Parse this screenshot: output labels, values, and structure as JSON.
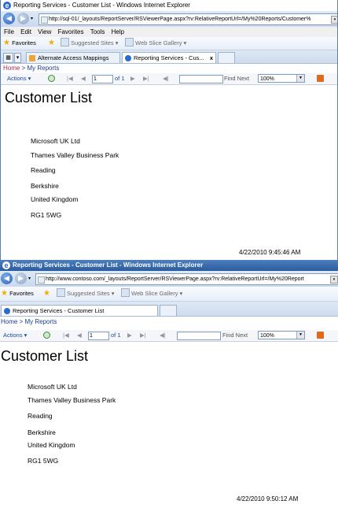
{
  "top": {
    "title": "Reporting Services - Customer List - Windows Internet Explorer",
    "url": "http://sql-01/_layouts/ReportServer/RSViewerPage.aspx?rv:RelativeReportUrl=/My%20Reports/Customer%",
    "menu": [
      "File",
      "Edit",
      "View",
      "Favorites",
      "Tools",
      "Help"
    ],
    "favorites_label": "Favorites",
    "suggested_sites": "Suggested Sites ▾",
    "web_slice_gallery": "Web Slice Gallery ▾",
    "tabs": [
      "Alternate Access Mappings",
      "Reporting Services - Cus..."
    ],
    "tab_close": "x",
    "breadcrumb_home": "Home",
    "breadcrumb_sep": ">",
    "breadcrumb_current": "My Reports",
    "actions": "Actions ▾",
    "page_number": "1",
    "of_pages": "of 1",
    "find_next": "Find Next",
    "zoom": "100%",
    "report_title": "Customer List",
    "address_lines": [
      "Microsoft UK Ltd",
      "Thames Valley Business Park",
      "Reading",
      "Berkshire",
      "United Kingdom",
      "RG1 5WG"
    ],
    "timestamp": "4/22/2010 9:45:46 AM"
  },
  "bottom": {
    "title": "Reporting Services - Customer List - Windows Internet Explorer",
    "url": "http://www.contoso.com/_layouts/ReportServer/RSViewerPage.aspx?rv:RelativeReportUrl=/My%20Report",
    "favorites_label": "Favorites",
    "suggested_sites": "Suggested Sites ▾",
    "web_slice_gallery": "Web Slice Gallery ▾",
    "tabs": [
      "Reporting Services - Customer List"
    ],
    "breadcrumb_home": "Home",
    "breadcrumb_sep": ">",
    "breadcrumb_current": "My Reports",
    "actions": "Actions ▾",
    "page_number": "1",
    "of_pages": "of 1",
    "find_next": "Find Next",
    "zoom": "100%",
    "report_title": "Customer List",
    "address_lines": [
      "Microsoft UK Ltd",
      "Thames Valley Business Park",
      "Reading",
      "Berkshire",
      "United Kingdom",
      "RG1 5WG"
    ],
    "timestamp": "4/22/2010 9:50:12 AM"
  },
  "icons": {
    "browser": "ie-icon",
    "back": "back-arrow-icon",
    "forward": "forward-arrow-icon",
    "refresh": "refresh-icon",
    "first": "first-page-icon",
    "prev": "previous-page-icon",
    "next": "next-page-icon",
    "last": "last-page-icon",
    "back_parent": "back-to-parent-icon",
    "export": "export-icon"
  },
  "colors": {
    "accent": "#2a5c9e",
    "home_link": "#b02a4a",
    "link": "#1a3f8f"
  }
}
